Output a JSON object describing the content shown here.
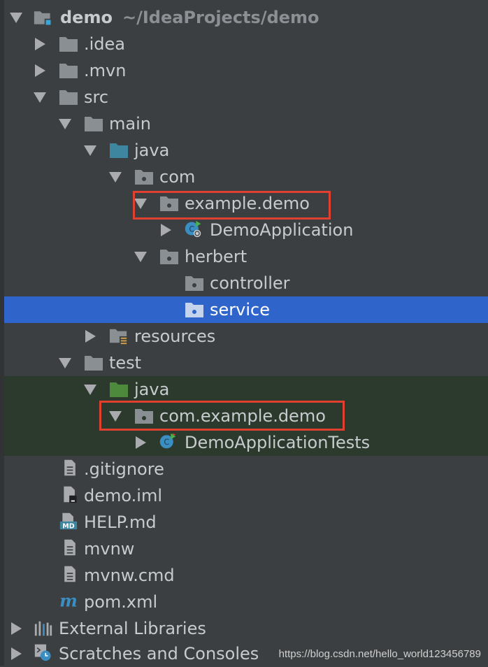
{
  "tree": {
    "root": {
      "name": "demo",
      "path": "~/IdeaProjects/demo"
    },
    "idea": ".idea",
    "mvn": ".mvn",
    "src": "src",
    "main": "main",
    "main_java": "java",
    "com": "com",
    "example_demo": "example.demo",
    "demo_application": "DemoApplication",
    "herbert": "herbert",
    "controller": "controller",
    "service": "service",
    "resources": "resources",
    "test": "test",
    "test_java": "java",
    "test_pkg": "com.example.demo",
    "demo_application_tests": "DemoApplicationTests",
    "gitignore": ".gitignore",
    "demo_iml": "demo.iml",
    "help_md": "HELP.md",
    "mvnw": "mvnw",
    "mvnw_cmd": "mvnw.cmd",
    "pom_xml": "pom.xml",
    "external_libraries": "External Libraries",
    "scratches": "Scratches and Consoles"
  },
  "watermark": "https://blog.csdn.net/hello_world123456789",
  "colors": {
    "background": "#3c3f41",
    "selection": "#2f65ca",
    "test_highlight": "#2c3a2e",
    "annotation_box": "#e0402f",
    "folder_gray": "#8a8f94",
    "source_folder_blue": "#3e86a0",
    "test_folder_green": "#4e8a3c"
  }
}
